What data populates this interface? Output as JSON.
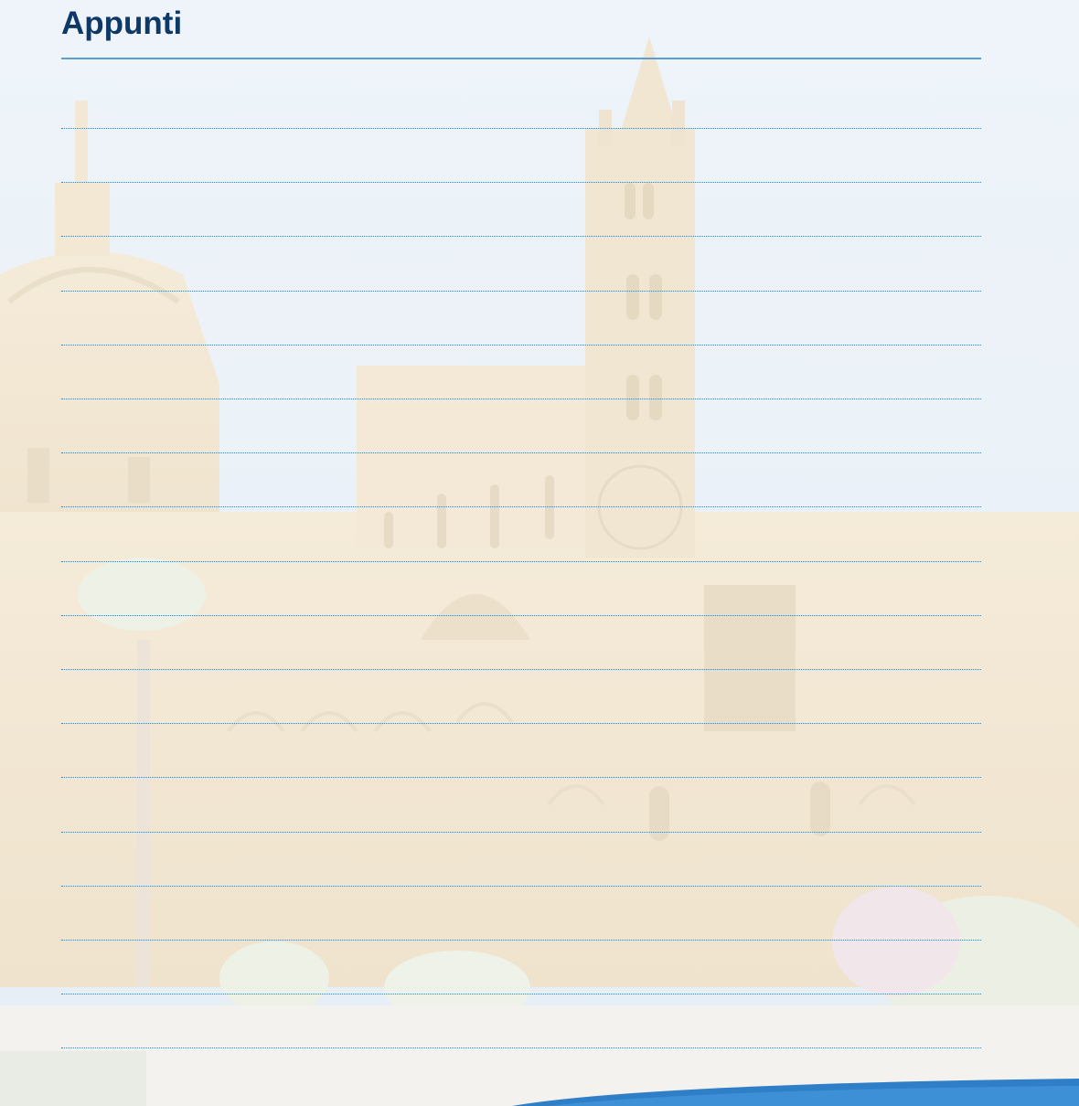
{
  "page": {
    "title": "Appunti",
    "line_count": 18
  },
  "colors": {
    "title": "#0e3865",
    "title_rule": "#5a9fd4",
    "dotted_lines": "#3f7fc0",
    "footer_swoosh": "#2f7fc8"
  }
}
